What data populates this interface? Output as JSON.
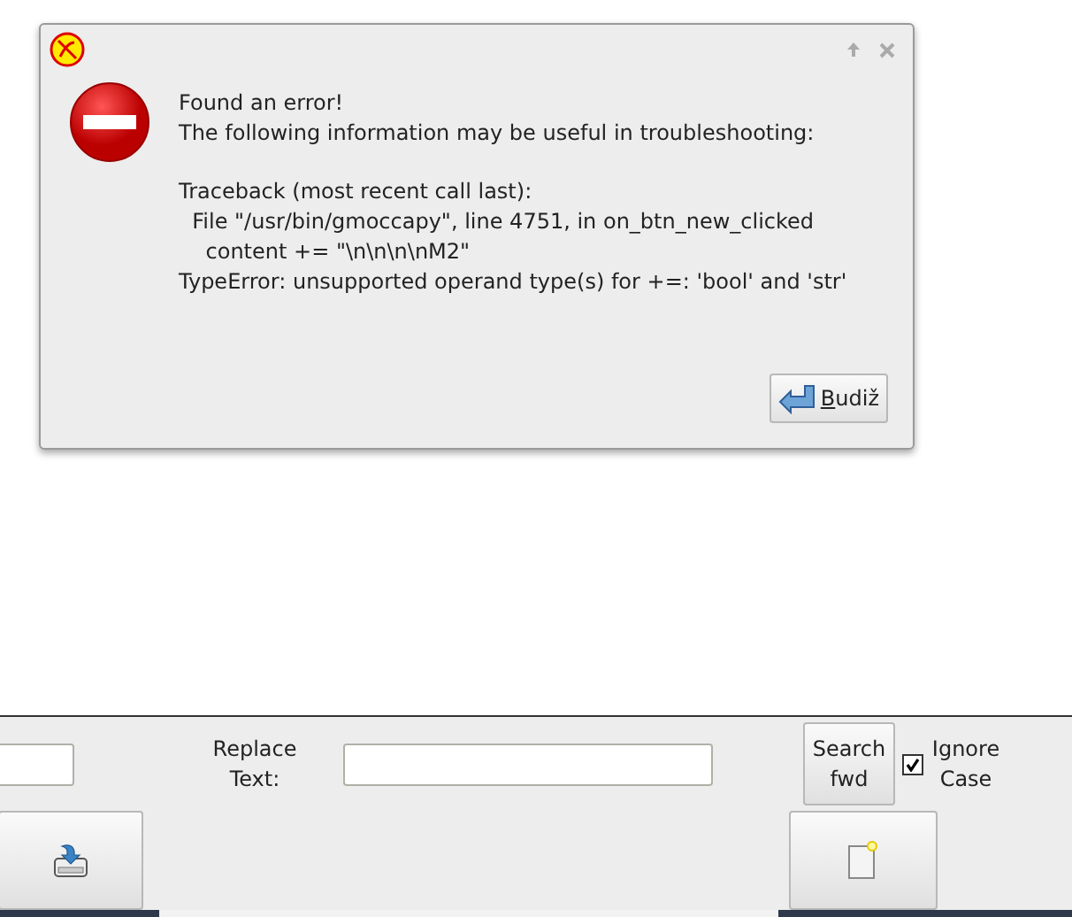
{
  "dialog": {
    "message": [
      [
        "Found an error!",
        "The following information may be useful in troubleshooting:"
      ],
      [
        "Traceback (most recent call last):",
        "  File \"/usr/bin/gmoccapy\", line 4751, in on_btn_new_clicked",
        "    content += \"\\n\\n\\n\\nM2\"",
        "TypeError: unsupported operand type(s) for +=: 'bool' and 'str'"
      ]
    ],
    "button": {
      "mnemonic": "B",
      "label": "udiž"
    }
  },
  "panel": {
    "replace_label": "Replace Text:",
    "search_button": "Search fwd",
    "ignore_case": {
      "label": "Ignore Case",
      "checked": true
    }
  }
}
